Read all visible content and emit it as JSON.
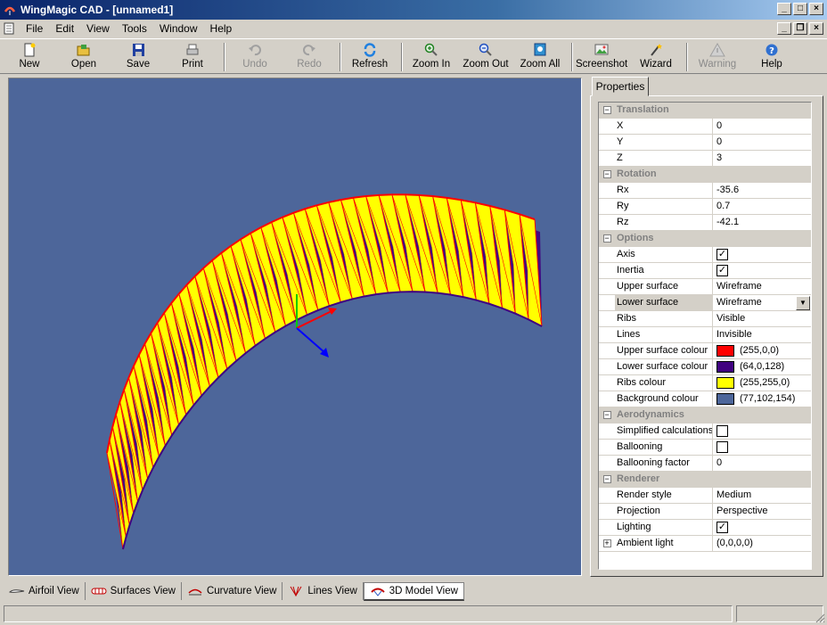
{
  "window": {
    "title": "WingMagic CAD - [unnamed1]"
  },
  "menu": [
    "File",
    "Edit",
    "View",
    "Tools",
    "Window",
    "Help"
  ],
  "toolbar": {
    "new": "New",
    "open": "Open",
    "save": "Save",
    "print": "Print",
    "undo": "Undo",
    "redo": "Redo",
    "refresh": "Refresh",
    "zoom_in": "Zoom In",
    "zoom_out": "Zoom Out",
    "zoom_all": "Zoom All",
    "screenshot": "Screenshot",
    "wizard": "Wizard",
    "warning": "Warning",
    "help": "Help"
  },
  "properties": {
    "tab": "Properties",
    "translation": {
      "label": "Translation",
      "x_label": "X",
      "x": "0",
      "y_label": "Y",
      "y": "0",
      "z_label": "Z",
      "z": "3"
    },
    "rotation": {
      "label": "Rotation",
      "rx_label": "Rx",
      "rx": "-35.6",
      "ry_label": "Ry",
      "ry": "0.7",
      "rz_label": "Rz",
      "rz": "-42.1"
    },
    "options": {
      "label": "Options",
      "axis_label": "Axis",
      "axis_checked": true,
      "inertia_label": "Inertia",
      "inertia_checked": true,
      "upper_surface_label": "Upper surface",
      "upper_surface": "Wireframe",
      "lower_surface_label": "Lower surface",
      "lower_surface": "Wireframe",
      "ribs_label": "Ribs",
      "ribs": "Visible",
      "lines_label": "Lines",
      "lines": "Invisible",
      "upper_colour_label": "Upper surface colour",
      "upper_colour": "(255,0,0)",
      "upper_colour_hex": "#ff0000",
      "lower_colour_label": "Lower surface colour",
      "lower_colour": "(64,0,128)",
      "lower_colour_hex": "#400080",
      "ribs_colour_label": "Ribs colour",
      "ribs_colour": "(255,255,0)",
      "ribs_colour_hex": "#ffff00",
      "bg_colour_label": "Background colour",
      "bg_colour": "(77,102,154)",
      "bg_colour_hex": "#4d669a"
    },
    "aerodynamics": {
      "label": "Aerodynamics",
      "simplified_label": "Simplified calculations",
      "simplified_checked": false,
      "ballooning_label": "Ballooning",
      "ballooning_checked": false,
      "ballooning_factor_label": "Ballooning factor",
      "ballooning_factor": "0"
    },
    "renderer": {
      "label": "Renderer",
      "render_style_label": "Render style",
      "render_style": "Medium",
      "projection_label": "Projection",
      "projection": "Perspective",
      "lighting_label": "Lighting",
      "lighting_checked": true,
      "ambient_label": "Ambient light",
      "ambient": "(0,0,0,0)"
    }
  },
  "view_tabs": {
    "airfoil": "Airfoil View",
    "surfaces": "Surfaces View",
    "curvature": "Curvature View",
    "lines": "Lines View",
    "model3d": "3D Model View"
  },
  "colors": {
    "axis_x": "#ff0000",
    "axis_y": "#00cc00",
    "axis_z": "#0000ff"
  }
}
